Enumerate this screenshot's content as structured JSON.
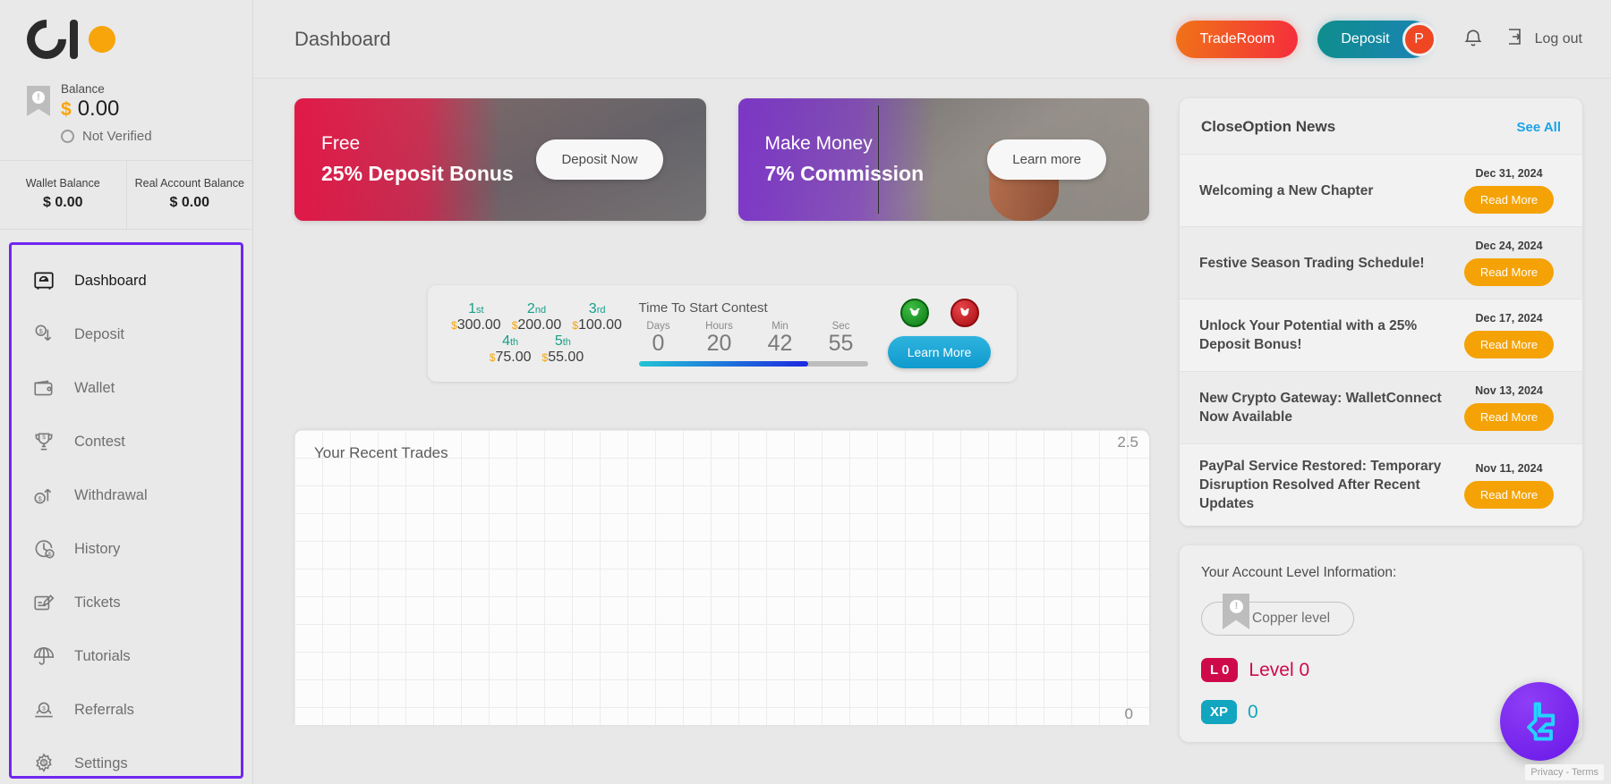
{
  "sidebar": {
    "logo_name": "closeoption-logo",
    "balance": {
      "label": "Balance",
      "currency": "$",
      "value": "0.00",
      "verify_status": "Not Verified"
    },
    "wallet_balance": {
      "label": "Wallet Balance",
      "value": "$ 0.00"
    },
    "real_account_balance": {
      "label": "Real Account Balance",
      "value": "$ 0.00"
    },
    "items": [
      {
        "label": "Dashboard",
        "icon": "dashboard-icon",
        "active": true
      },
      {
        "label": "Deposit",
        "icon": "deposit-icon",
        "active": false
      },
      {
        "label": "Wallet",
        "icon": "wallet-icon",
        "active": false
      },
      {
        "label": "Contest",
        "icon": "trophy-icon",
        "active": false
      },
      {
        "label": "Withdrawal",
        "icon": "withdrawal-icon",
        "active": false
      },
      {
        "label": "History",
        "icon": "history-clock-icon",
        "active": false
      },
      {
        "label": "Tickets",
        "icon": "tickets-icon",
        "active": false
      },
      {
        "label": "Tutorials",
        "icon": "umbrella-icon",
        "active": false
      },
      {
        "label": "Referrals",
        "icon": "referrals-icon",
        "active": false
      },
      {
        "label": "Settings",
        "icon": "gear-icon",
        "active": false
      }
    ]
  },
  "topbar": {
    "title": "Dashboard",
    "trade_room_label": "TradeRoom",
    "deposit_label": "Deposit",
    "avatar_initial": "P",
    "logout_label": "Log out",
    "colors": {
      "trade_from": "#f07417",
      "trade_to": "#f52d3c",
      "deposit_from": "#0f8e8c",
      "deposit_to": "#1b83b6",
      "avatar": "#ef4623"
    }
  },
  "banners": [
    {
      "line1": "Free",
      "line2": "25% Deposit Bonus",
      "cta": "Deposit Now",
      "accent": "#e61446"
    },
    {
      "line1": "Make Money",
      "line2": "7% Commission",
      "cta": "Learn more",
      "accent": "#7d32cd"
    }
  ],
  "contest": {
    "prizes_row1": [
      {
        "rank": "1",
        "ordinal": "st",
        "amount": "300.00"
      },
      {
        "rank": "2",
        "ordinal": "nd",
        "amount": "200.00"
      },
      {
        "rank": "3",
        "ordinal": "rd",
        "amount": "100.00"
      }
    ],
    "prizes_row2": [
      {
        "rank": "4",
        "ordinal": "th",
        "amount": "75.00"
      },
      {
        "rank": "5",
        "ordinal": "th",
        "amount": "55.00"
      }
    ],
    "currency": "$",
    "timer_title": "Time To Start Contest",
    "units": [
      {
        "label": "Days",
        "value": "0"
      },
      {
        "label": "Hours",
        "value": "20"
      },
      {
        "label": "Min",
        "value": "42"
      },
      {
        "label": "Sec",
        "value": "55"
      }
    ],
    "progress_percent": 74,
    "bull_icon": "bull-icon",
    "bear_icon": "bear-icon",
    "learn_more_label": "Learn More"
  },
  "chart_data": {
    "type": "line",
    "title": "Your Recent Trades",
    "x": [],
    "values": [],
    "ylim": [
      0,
      2.5
    ],
    "ytick_labels": [
      "0",
      "2.5"
    ],
    "xlabel": "",
    "ylabel": "",
    "grid": true,
    "legend": "none"
  },
  "news": {
    "title": "CloseOption News",
    "see_all": "See All",
    "read_more_label": "Read More",
    "items": [
      {
        "title": "Welcoming a New Chapter",
        "date": "Dec 31, 2024"
      },
      {
        "title": "Festive Season Trading Schedule!",
        "date": "Dec 24, 2024"
      },
      {
        "title": "Unlock Your Potential with a 25% Deposit Bonus!",
        "date": "Dec 17, 2024"
      },
      {
        "title": "New Crypto Gateway: WalletConnect Now Available",
        "date": "Nov 13, 2024"
      },
      {
        "title": "PayPal Service Restored: Temporary Disruption Resolved After Recent Updates",
        "date": "Nov 11, 2024"
      }
    ]
  },
  "account_level": {
    "heading": "Your Account Level Information:",
    "level_name": "Copper level",
    "level_badge": "L 0",
    "level_text": "Level 0",
    "xp_badge": "XP",
    "xp_value": "0",
    "colors": {
      "level": "#cf0a4a",
      "xp": "#12a5c0"
    }
  },
  "chat_widget": {
    "icon": "chat-logo-icon",
    "privacy_text": "Privacy - Terms"
  }
}
